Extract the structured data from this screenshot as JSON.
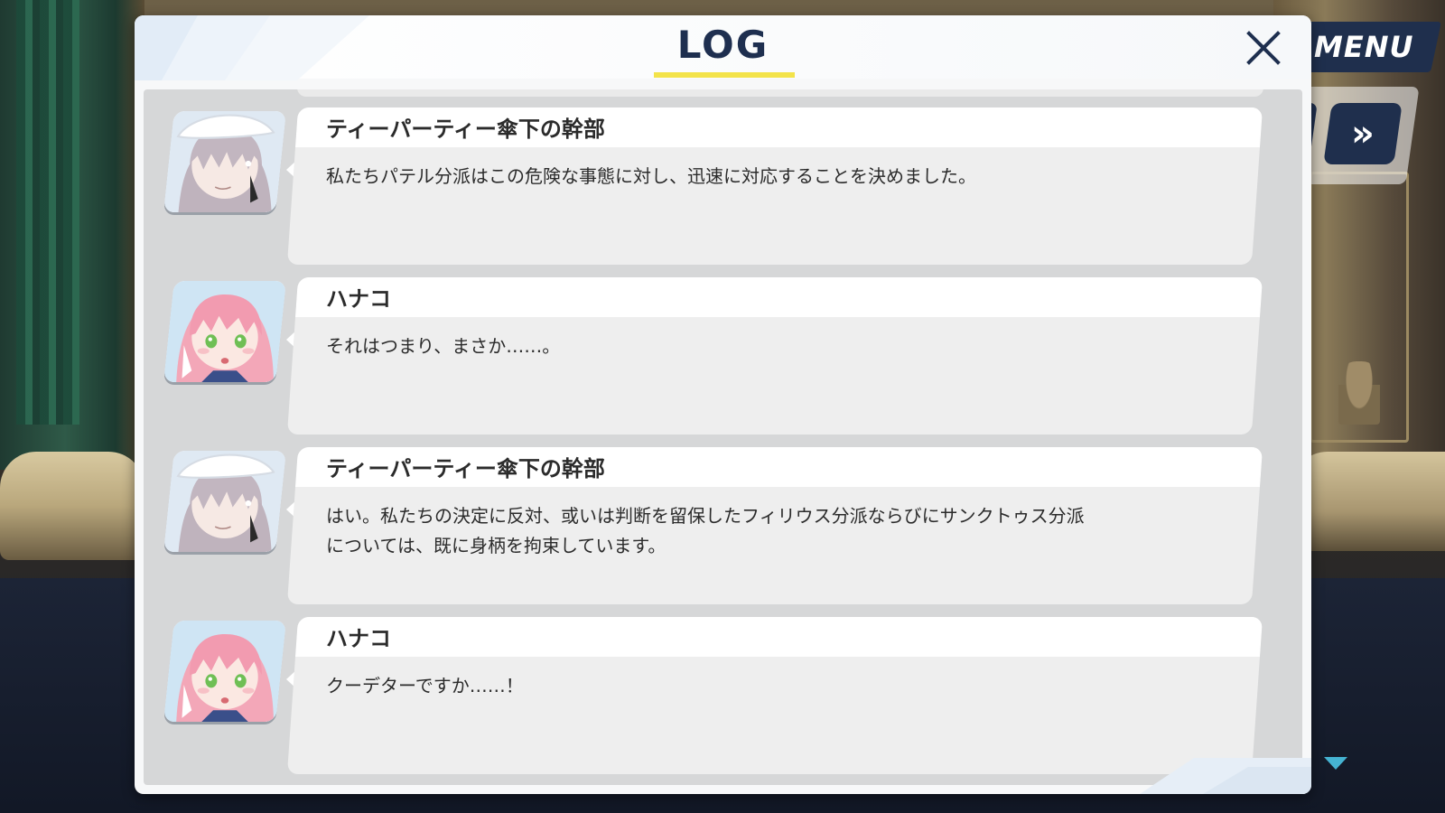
{
  "header": {
    "title": "LOG",
    "close_icon": "close-icon"
  },
  "hud": {
    "menu_label": "MENU",
    "fast_forward_label": "»"
  },
  "entries": [
    {
      "speaker": "ティーパーティー傘下の幹部",
      "text": "私たちパテル分派はこの危険な事態に対し、迅速に対応することを決めました。",
      "avatar": "officer"
    },
    {
      "speaker": "ハナコ",
      "text": "それはつまり、まさか……。",
      "avatar": "hanako"
    },
    {
      "speaker": "ティーパーティー傘下の幹部",
      "text": "はい。私たちの決定に反対、或いは判断を留保したフィリウス分派ならびにサンクトゥス分派\nについては、既に身柄を拘束しています。",
      "avatar": "officer"
    },
    {
      "speaker": "ハナコ",
      "text": "クーデターですか……！",
      "avatar": "hanako"
    }
  ],
  "colors": {
    "title": "#1e2f4f",
    "underline": "#f3e34a",
    "hud": "#1f2f4d",
    "indicator": "#45b3d2"
  }
}
